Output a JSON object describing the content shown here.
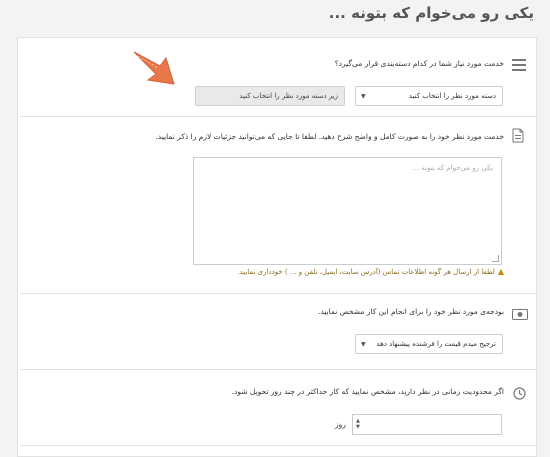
{
  "page": {
    "title": "یکی رو می‌خوام که بتونه ..."
  },
  "category": {
    "question": "خدمت مورد نیاز شما در کدام دسته‌بندی قرار می‌گیرد؟",
    "main_select": "دسته مورد نظر را انتخاب کنید",
    "sub_select": "زیر دسته مورد نظر را انتخاب کنید"
  },
  "description": {
    "question": "خدمت مورد نظر خود را به صورت کامل و واضح شرح دهید. لطفا تا جایی که می‌توانید جزئیات لازم را ذکر نمایید.",
    "placeholder": "یکی رو می‌خوام که بتونه ...",
    "warning": "لطفا از ارسال هر گونه اطلاعات تماس (آدرس سایت، ایمیل، تلفن و ... ) خودداری نمایید."
  },
  "budget": {
    "question": "بودجه‌ی مورد نظر خود را برای انجام این کار مشخص نمایید.",
    "select": "ترجیح میدم قیمت را فرشنده پیشنهاد دهد"
  },
  "deadline": {
    "question": "اگر محدودیت زمانی در نظر دارید، مشخص نمایید که کار حداکثر در چند روز تحویل شود.",
    "unit_label": "روز"
  },
  "colors": {
    "accent_arrow": "#e8784a",
    "warning": "#c08a00"
  }
}
